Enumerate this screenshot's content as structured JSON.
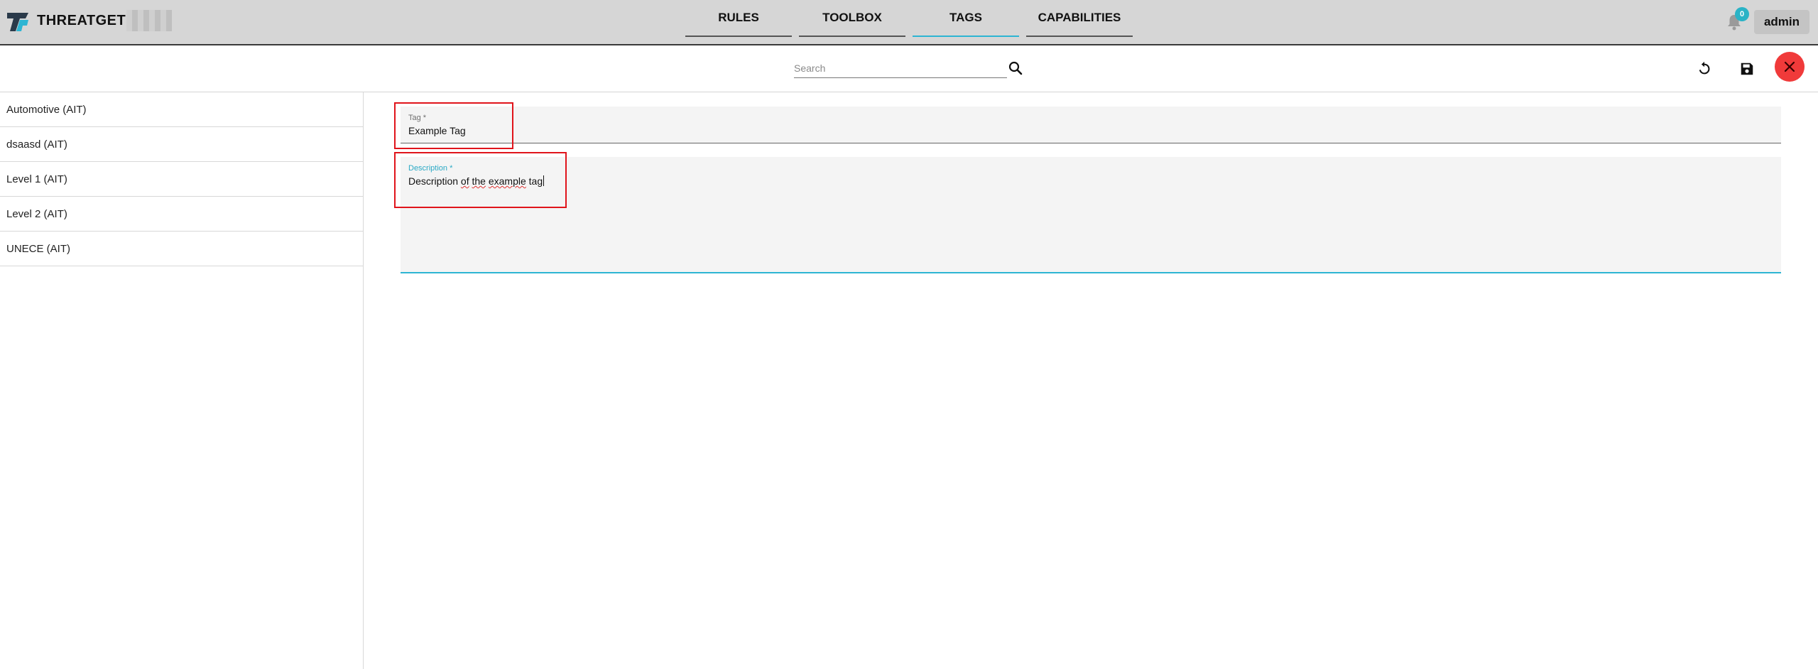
{
  "app": {
    "brand": "THREATGET"
  },
  "nav": {
    "tabs": [
      {
        "label": "RULES",
        "active": false
      },
      {
        "label": "TOOLBOX",
        "active": false
      },
      {
        "label": "TAGS",
        "active": true
      },
      {
        "label": "CAPABILITIES",
        "active": false
      }
    ]
  },
  "header": {
    "notifications_count": "0",
    "user_label": "admin",
    "accent_color": "#2db5d3"
  },
  "toolbar": {
    "search_placeholder": "Search",
    "search_value": "",
    "icons": [
      "search-icon",
      "reset-icon",
      "save-icon",
      "close-icon"
    ],
    "close_color": "#f03a3a"
  },
  "sidebar": {
    "items": [
      {
        "label": "Automotive (AIT)"
      },
      {
        "label": "dsaasd (AIT)"
      },
      {
        "label": "Level 1 (AIT)"
      },
      {
        "label": "Level 2 (AIT)"
      },
      {
        "label": "UNECE (AIT)"
      }
    ]
  },
  "form": {
    "tag": {
      "label": "Tag *",
      "value": "Example Tag"
    },
    "description": {
      "label": "Description *",
      "value_parts": [
        "Description ",
        "of",
        " ",
        "the",
        " ",
        "example",
        " tag"
      ]
    }
  },
  "annotations": {
    "highlight_color": "#e0141b"
  }
}
